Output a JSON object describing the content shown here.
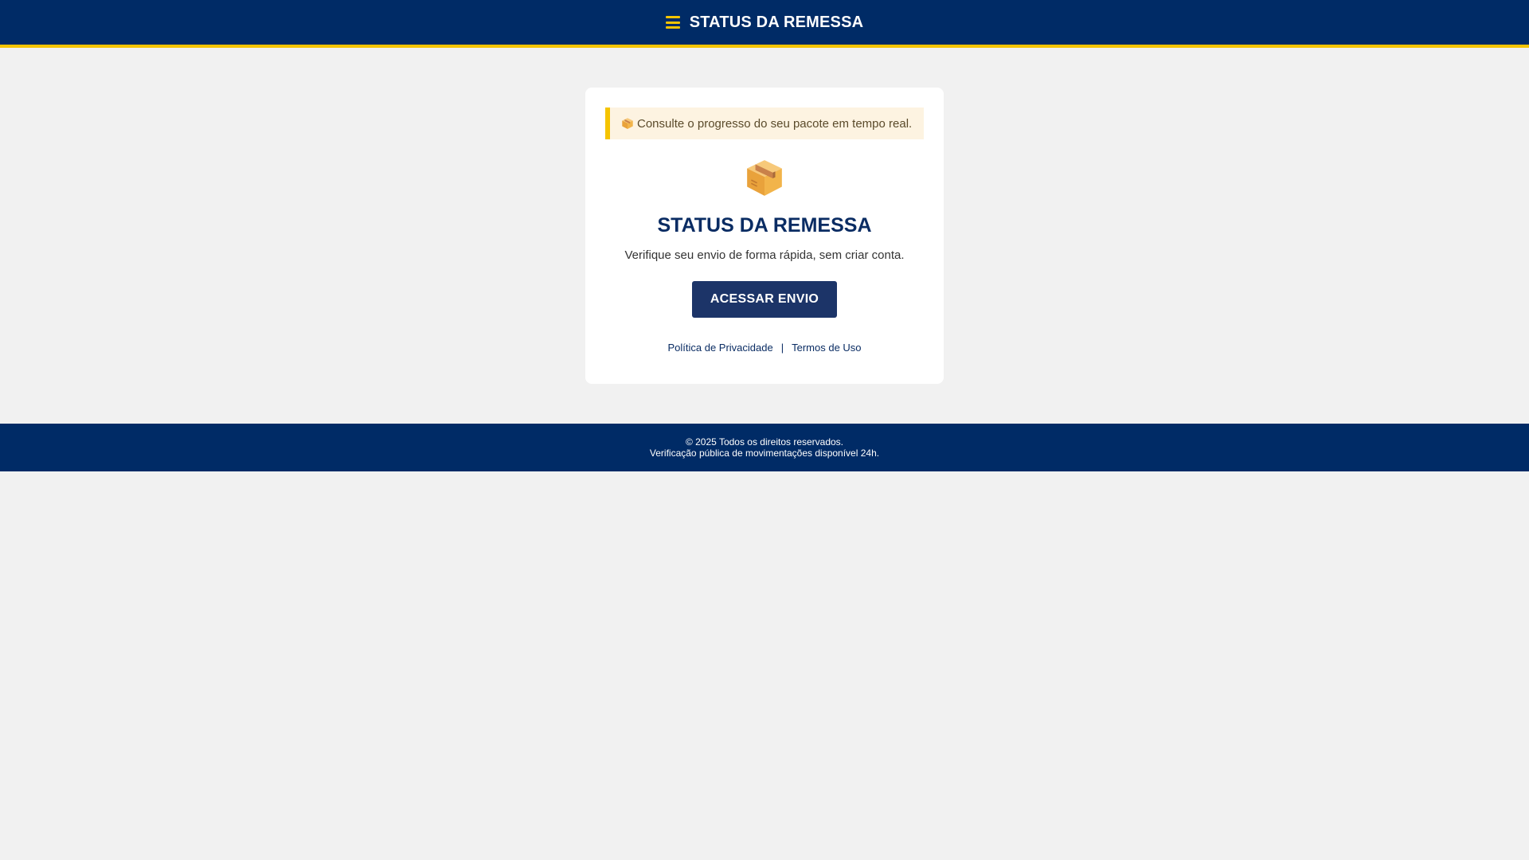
{
  "header": {
    "menu_icon": "hamburger-menu-icon",
    "title": "STATUS DA REMESSA"
  },
  "notice": {
    "icon": "package-icon",
    "text": "Consulte o progresso do seu pacote em tempo real."
  },
  "card": {
    "icon": "package-icon",
    "title": "STATUS DA REMESSA",
    "subtitle": "Verifique seu envio de forma rápida, sem criar conta.",
    "button_label": "ACESSAR ENVIO"
  },
  "links": {
    "privacy": "Política de Privacidade",
    "separator": "|",
    "terms": "Termos de Uso"
  },
  "footer": {
    "copyright": "© 2025 Todos os direitos reservados.",
    "note": "Verificação pública de movimentações disponível 24h."
  },
  "colors": {
    "header_bg": "#002b66",
    "accent": "#f5c400",
    "button_bg": "#1c3468",
    "title_color": "#0a2c63",
    "page_bg": "#f1f1f1"
  }
}
